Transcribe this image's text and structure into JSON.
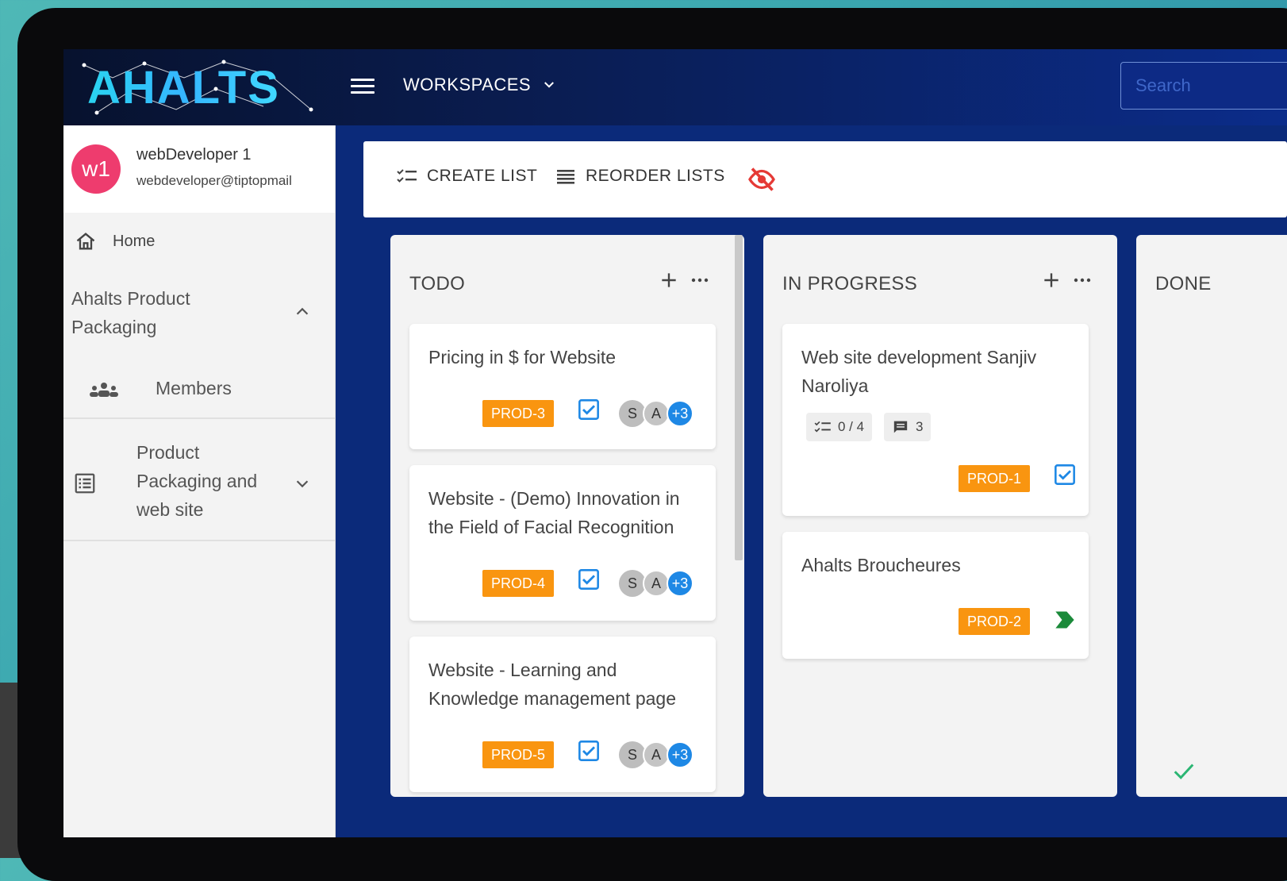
{
  "app": {
    "brand": "AHALTS",
    "workspaces_label": "WORKSPACES",
    "search_placeholder": "Search"
  },
  "user": {
    "initials": "w1",
    "name": "webDeveloper 1",
    "email": "webdeveloper@tiptopmail"
  },
  "sidebar": {
    "home_label": "Home",
    "project_label": "Ahalts Product Packaging",
    "members_label": "Members",
    "board_label": "Product Packaging and web site"
  },
  "toolbar": {
    "create_list": "CREATE LIST",
    "reorder_lists": "REORDER LISTS"
  },
  "colors": {
    "tag": "#f99510",
    "avatar": "#ee3c6e",
    "accent_blue": "#1e88e5",
    "done_green": "#2bb673",
    "status_green": "#1b8a3a"
  },
  "lists": [
    {
      "title": "TODO",
      "cards": [
        {
          "title": "Pricing in $ for Website",
          "tag": "PROD-3",
          "avatars": [
            "S",
            "A",
            "+3"
          ]
        },
        {
          "title": "Website - (Demo) Innovation in the Field of Facial Recognition",
          "tag": "PROD-4",
          "avatars": [
            "S",
            "A",
            "+3"
          ]
        },
        {
          "title": "Website - Learning and Knowledge management page",
          "tag": "PROD-5",
          "avatars": [
            "S",
            "A",
            "+3"
          ]
        }
      ]
    },
    {
      "title": "IN PROGRESS",
      "cards": [
        {
          "title": "Web site development Sanjiv Naroliya",
          "checklist": "0 / 4",
          "comments": "3",
          "tag": "PROD-1"
        },
        {
          "title": "Ahalts Broucheures",
          "tag": "PROD-2"
        }
      ]
    },
    {
      "title": "DONE",
      "cards": []
    }
  ]
}
